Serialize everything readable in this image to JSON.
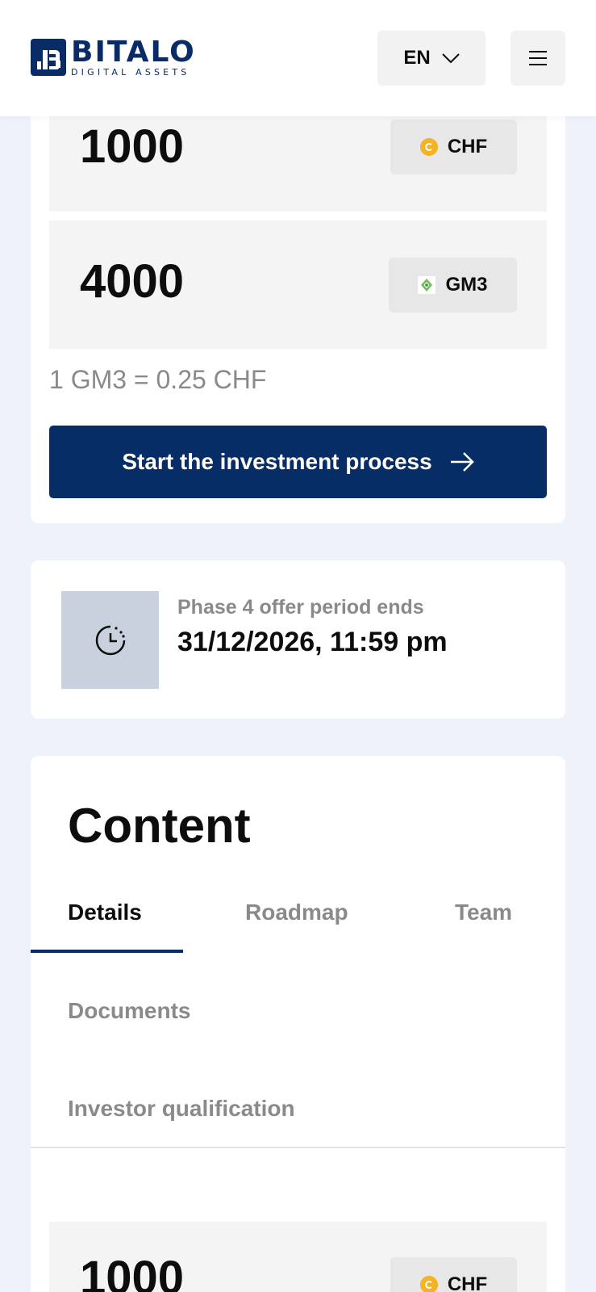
{
  "header": {
    "logo_title": "BITALO",
    "logo_subtitle": "DIGITAL ASSETS",
    "language": "EN"
  },
  "calculator": {
    "pay_amount": "1000",
    "pay_currency": "CHF",
    "receive_amount": "4000",
    "receive_currency": "GM3",
    "rate": "1 GM3 = 0.25 CHF",
    "invest_button": "Start the investment process"
  },
  "phase": {
    "label": "Phase 4 offer period ends",
    "date": "31/12/2026, 11:59 pm"
  },
  "content": {
    "title": "Content",
    "tabs": [
      "Details",
      "Roadmap",
      "Team",
      "Documents",
      "Investor qualification"
    ],
    "active_tab": "Details"
  },
  "bottom_calculator": {
    "pay_amount": "1000",
    "pay_currency": "CHF"
  },
  "colors": {
    "brand": "#062d66",
    "coin": "#f4b323",
    "page_bg": "#eef3fb"
  },
  "icons": {
    "chevron": "chevron-down-icon",
    "menu": "hamburger-menu-icon",
    "arrow": "arrow-right-icon",
    "clock": "clock-icon",
    "chf": "chf-coin-icon",
    "gm3": "gm3-token-icon"
  }
}
